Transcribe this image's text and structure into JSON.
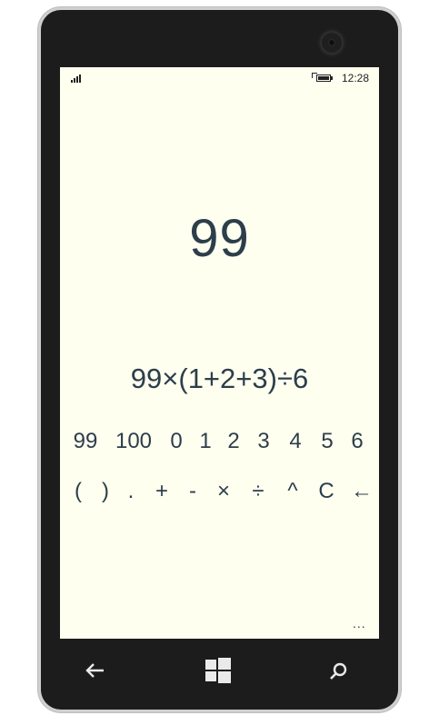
{
  "status_bar": {
    "time": "12:28",
    "signal_icon": "signal-bars-icon",
    "battery_icon": "battery-charging-icon"
  },
  "calculator": {
    "result": "99",
    "expression": "99×(1+2+3)÷6",
    "number_keys": [
      "99",
      "100",
      "0",
      "1",
      "2",
      "3",
      "4",
      "5",
      "6"
    ],
    "operator_keys": [
      "(",
      ")",
      ".",
      "+",
      "-",
      "×",
      "÷",
      "^",
      "C",
      "←"
    ],
    "more_menu": "..."
  },
  "nav_bar": {
    "back_icon": "back-arrow-icon",
    "start_icon": "windows-start-icon",
    "search_icon": "search-icon"
  },
  "colors": {
    "screen_background": "#fffff0",
    "text_primary": "#2c3e4a",
    "phone_body": "#1c1c1c"
  }
}
